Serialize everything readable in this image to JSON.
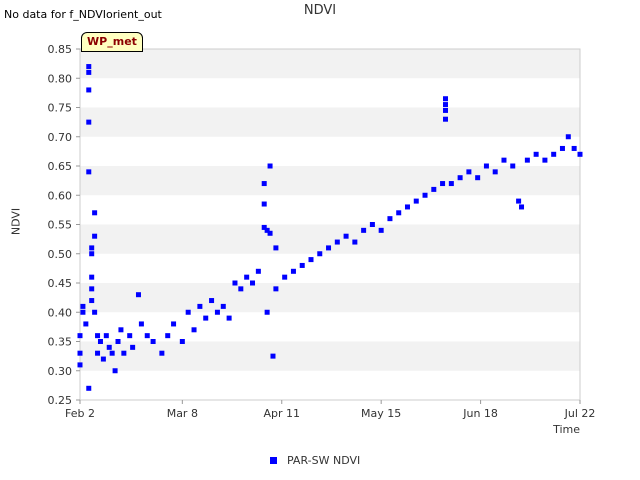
{
  "header": {
    "no_data_message": "No data for f_NDVIorient_out",
    "site_badge": "WP_met"
  },
  "chart_data": {
    "type": "scatter",
    "title": "NDVI",
    "xlabel": "Time",
    "ylabel": "NDVI",
    "ylim": [
      0.25,
      0.85
    ],
    "yticks": [
      "0.25",
      "0.30",
      "0.35",
      "0.40",
      "0.45",
      "0.50",
      "0.55",
      "0.60",
      "0.65",
      "0.70",
      "0.75",
      "0.80",
      "0.85"
    ],
    "xlim": [
      "2024-02-02",
      "2024-07-22"
    ],
    "xticks": [
      {
        "label": "Feb 2",
        "date": "2024-02-02"
      },
      {
        "label": "Mar 8",
        "date": "2024-03-08"
      },
      {
        "label": "Apr 11",
        "date": "2024-04-11"
      },
      {
        "label": "May 15",
        "date": "2024-05-15"
      },
      {
        "label": "Jun 18",
        "date": "2024-06-18"
      },
      {
        "label": "Jul 22",
        "date": "2024-07-22"
      }
    ],
    "grid": "alternating horizontal bands",
    "legend_position": "bottom-center",
    "series": [
      {
        "name": "PAR-SW NDVI",
        "color": "#0000ff",
        "marker": "square",
        "points": [
          [
            "2024-02-02",
            0.36
          ],
          [
            "2024-02-02",
            0.33
          ],
          [
            "2024-02-02",
            0.31
          ],
          [
            "2024-02-03",
            0.4
          ],
          [
            "2024-02-03",
            0.41
          ],
          [
            "2024-02-04",
            0.38
          ],
          [
            "2024-02-05",
            0.82
          ],
          [
            "2024-02-05",
            0.81
          ],
          [
            "2024-02-05",
            0.78
          ],
          [
            "2024-02-05",
            0.725
          ],
          [
            "2024-02-05",
            0.64
          ],
          [
            "2024-02-05",
            0.27
          ],
          [
            "2024-02-06",
            0.51
          ],
          [
            "2024-02-06",
            0.5
          ],
          [
            "2024-02-06",
            0.46
          ],
          [
            "2024-02-06",
            0.44
          ],
          [
            "2024-02-06",
            0.42
          ],
          [
            "2024-02-07",
            0.57
          ],
          [
            "2024-02-07",
            0.53
          ],
          [
            "2024-02-07",
            0.4
          ],
          [
            "2024-02-08",
            0.36
          ],
          [
            "2024-02-08",
            0.33
          ],
          [
            "2024-02-09",
            0.35
          ],
          [
            "2024-02-10",
            0.32
          ],
          [
            "2024-02-11",
            0.36
          ],
          [
            "2024-02-12",
            0.34
          ],
          [
            "2024-02-13",
            0.33
          ],
          [
            "2024-02-14",
            0.3
          ],
          [
            "2024-02-15",
            0.35
          ],
          [
            "2024-02-16",
            0.37
          ],
          [
            "2024-02-17",
            0.33
          ],
          [
            "2024-02-19",
            0.36
          ],
          [
            "2024-02-20",
            0.34
          ],
          [
            "2024-02-22",
            0.43
          ],
          [
            "2024-02-23",
            0.38
          ],
          [
            "2024-02-25",
            0.36
          ],
          [
            "2024-02-27",
            0.35
          ],
          [
            "2024-03-01",
            0.33
          ],
          [
            "2024-03-03",
            0.36
          ],
          [
            "2024-03-05",
            0.38
          ],
          [
            "2024-03-08",
            0.35
          ],
          [
            "2024-03-10",
            0.4
          ],
          [
            "2024-03-12",
            0.37
          ],
          [
            "2024-03-14",
            0.41
          ],
          [
            "2024-03-16",
            0.39
          ],
          [
            "2024-03-18",
            0.42
          ],
          [
            "2024-03-20",
            0.4
          ],
          [
            "2024-03-22",
            0.41
          ],
          [
            "2024-03-24",
            0.39
          ],
          [
            "2024-03-26",
            0.45
          ],
          [
            "2024-03-28",
            0.44
          ],
          [
            "2024-03-30",
            0.46
          ],
          [
            "2024-04-01",
            0.45
          ],
          [
            "2024-04-03",
            0.47
          ],
          [
            "2024-04-05",
            0.62
          ],
          [
            "2024-04-05",
            0.585
          ],
          [
            "2024-04-05",
            0.545
          ],
          [
            "2024-04-06",
            0.54
          ],
          [
            "2024-04-06",
            0.4
          ],
          [
            "2024-04-07",
            0.65
          ],
          [
            "2024-04-07",
            0.535
          ],
          [
            "2024-04-08",
            0.325
          ],
          [
            "2024-04-09",
            0.51
          ],
          [
            "2024-04-09",
            0.44
          ],
          [
            "2024-04-12",
            0.46
          ],
          [
            "2024-04-15",
            0.47
          ],
          [
            "2024-04-18",
            0.48
          ],
          [
            "2024-04-21",
            0.49
          ],
          [
            "2024-04-24",
            0.5
          ],
          [
            "2024-04-27",
            0.51
          ],
          [
            "2024-04-30",
            0.52
          ],
          [
            "2024-05-03",
            0.53
          ],
          [
            "2024-05-06",
            0.52
          ],
          [
            "2024-05-09",
            0.54
          ],
          [
            "2024-05-12",
            0.55
          ],
          [
            "2024-05-15",
            0.54
          ],
          [
            "2024-05-18",
            0.56
          ],
          [
            "2024-05-21",
            0.57
          ],
          [
            "2024-05-24",
            0.58
          ],
          [
            "2024-05-27",
            0.59
          ],
          [
            "2024-05-30",
            0.6
          ],
          [
            "2024-06-02",
            0.61
          ],
          [
            "2024-06-05",
            0.62
          ],
          [
            "2024-06-06",
            0.765
          ],
          [
            "2024-06-06",
            0.755
          ],
          [
            "2024-06-06",
            0.745
          ],
          [
            "2024-06-06",
            0.73
          ],
          [
            "2024-06-08",
            0.62
          ],
          [
            "2024-06-11",
            0.63
          ],
          [
            "2024-06-14",
            0.64
          ],
          [
            "2024-06-17",
            0.63
          ],
          [
            "2024-06-20",
            0.65
          ],
          [
            "2024-06-23",
            0.64
          ],
          [
            "2024-06-26",
            0.66
          ],
          [
            "2024-06-29",
            0.65
          ],
          [
            "2024-07-01",
            0.59
          ],
          [
            "2024-07-02",
            0.58
          ],
          [
            "2024-07-04",
            0.66
          ],
          [
            "2024-07-07",
            0.67
          ],
          [
            "2024-07-10",
            0.66
          ],
          [
            "2024-07-13",
            0.67
          ],
          [
            "2024-07-16",
            0.68
          ],
          [
            "2024-07-18",
            0.7
          ],
          [
            "2024-07-20",
            0.68
          ],
          [
            "2024-07-22",
            0.67
          ]
        ]
      }
    ]
  }
}
